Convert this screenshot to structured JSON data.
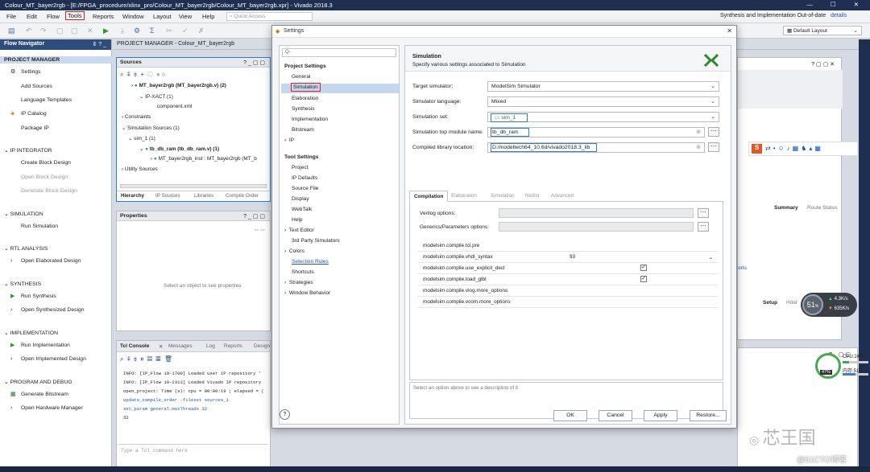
{
  "window": {
    "title": "Colour_MT_bayer2rgb - [E:/FPGA_procedure/xlinx_pro/Colour_MT_bayer2rgb/Colour_MT_bayer2rgb.xpr] - Vivado 2018.3"
  },
  "menu": {
    "items": [
      "File",
      "Edit",
      "Flow",
      "Tools",
      "Reports",
      "Window",
      "Layout",
      "View",
      "Help"
    ],
    "quick_access": "Quick Access",
    "status": "Synthesis and Implementation Out-of-date",
    "details": "details",
    "layout": "Default Layout"
  },
  "nav": {
    "title": "Flow Navigator",
    "project_manager": "PROJECT MANAGER",
    "settings": "Settings",
    "add_sources": "Add Sources",
    "language_templates": "Language Templates",
    "ip_catalog": "IP Catalog",
    "package_ip": "Package IP",
    "ip_integrator": "IP INTEGRATOR",
    "create_block": "Create Block Design",
    "open_block": "Open Block Design",
    "generate_block": "Generate Block Design",
    "simulation": "SIMULATION",
    "run_sim": "Run Simulation",
    "rtl": "RTL ANALYSIS",
    "open_elab": "Open Elaborated Design",
    "synthesis": "SYNTHESIS",
    "run_synth": "Run Synthesis",
    "open_synth": "Open Synthesized Design",
    "implementation": "IMPLEMENTATION",
    "run_impl": "Run Implementation",
    "open_impl": "Open Implemented Design",
    "prog": "PROGRAM AND DEBUG",
    "gen_bit": "Generate Bitstream",
    "open_hw": "Open Hardware Manager"
  },
  "pm_header": "PROJECT MANAGER - Colour_MT_bayer2rgb",
  "sources": {
    "title": "Sources",
    "count": "0",
    "rows": [
      "MT_bayer2rgb (MT_bayer2rgb.v) (2)",
      "IP-XACT (1)",
      "component.xml",
      "Constraints",
      "Simulation Sources (1)",
      "sim_1 (1)",
      "tb_db_ram (tb_db_ram.v) (1)",
      "MT_bayer2rgb_inst : MT_bayer2rgb (MT_b",
      "Utility Sources"
    ],
    "tabs": [
      "Hierarchy",
      "IP Sources",
      "Libraries",
      "Compile Order"
    ]
  },
  "properties": {
    "title": "Properties",
    "empty": "Select an object to see properties"
  },
  "tcl": {
    "tabs": [
      "Tcl Console",
      "Messages",
      "Log",
      "Reports",
      "Design"
    ],
    "lines": [
      "INFO: [IP_Flow 19-1700] Loaded user IP repository '",
      "INFO: [IP_Flow 19-2313] Loaded Vivado IP repository",
      "open_project: Time (s): cpu = 00:00:19 ; elapsed = (",
      "update_compile_order -fileset sources_1",
      "set_param general.maxThreads 32",
      "32"
    ],
    "input_placeholder": "Type a Tcl command here"
  },
  "dialog": {
    "title": "Settings",
    "search_placeholder": "Q-",
    "project_settings": "Project Settings",
    "project_items": [
      "General",
      "Simulation",
      "Elaboration",
      "Synthesis",
      "Implementation",
      "Bitstream",
      "IP"
    ],
    "tool_settings": "Tool Settings",
    "tool_items": [
      "Project",
      "IP Defaults",
      "Source File",
      "Display",
      "WebTalk",
      "Help",
      "Text Editor",
      "3rd Party Simulators",
      "Colors",
      "Selection Rules",
      "Shortcuts",
      "Strategies",
      "Window Behavior"
    ],
    "heading": "Simulation",
    "subheading": "Specify various settings associated to Simulation",
    "target_label": "Target simulator:",
    "target_value": "ModelSim Simulator",
    "lang_label": "Simulator language:",
    "lang_value": "Mixed",
    "set_label": "Simulation set:",
    "set_value": "sim_1",
    "top_label": "Simulation top module name:",
    "top_value": "tb_db_ram",
    "lib_label": "Compiled library location:",
    "lib_value": "D:/modeltech64_10.6d/vivado2018.3_lib",
    "tabs": [
      "Compilation",
      "Elaboration",
      "Simulation",
      "Netlist",
      "Advanced"
    ],
    "verilog_options": "Verilog options:",
    "generics": "Generics/Parameters options:",
    "props": [
      {
        "name": "modelsim.compile.tcl.pre",
        "value": ""
      },
      {
        "name": "modelsim.compile.vhdl_syntax",
        "value": "93"
      },
      {
        "name": "modelsim.compile.use_explicit_decl",
        "value": "✓"
      },
      {
        "name": "modelsim.compile.load_glbl",
        "value": "✓"
      },
      {
        "name": "modelsim.compile.vlog.more_options",
        "value": ""
      },
      {
        "name": "modelsim.compile.vcom.more_options",
        "value": ""
      }
    ],
    "desc": "Select an option above to see a description of it",
    "ok": "OK",
    "cancel": "Cancel",
    "apply": "Apply",
    "restore": "Restore...",
    "help": "?"
  },
  "background": {
    "summary": "Summary",
    "route_status": "Route Status",
    "setup": "Setup",
    "hold": "Hold",
    "reports": "orts"
  },
  "overlay": {
    "gauge": "51",
    "gauge_unit": "%",
    "up": "4.3K/s",
    "down": "635K/s",
    "cpu": "CPU:24%",
    "mem": "内存:51%",
    "net_badge": "47%",
    "watermark": "芯王国",
    "site": "@51CTO博客"
  }
}
